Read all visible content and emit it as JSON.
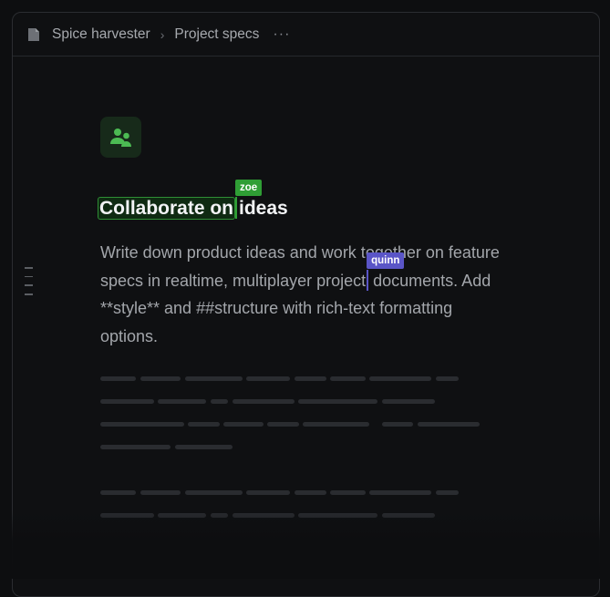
{
  "breadcrumb": {
    "project": "Spice harvester",
    "separator": "›",
    "page": "Project specs",
    "more": "···"
  },
  "icons": {
    "doc": "file-icon",
    "app": "users-icon",
    "more": "more-horizontal-icon",
    "handle": "drag-handle-icon"
  },
  "colors": {
    "zoe": "#2f9e35",
    "quinn": "#5a55c7",
    "app_icon_bg": "#172a1a",
    "app_icon_fg": "#4cbb53"
  },
  "document": {
    "heading_highlighted": "Collaborate on",
    "heading_rest": "ideas",
    "body_part1": "Write down product ideas and work together on feature specs in realtime, multiplayer project",
    "body_part2": " documents. Add **style** and ##structure with rich-text formatting options."
  },
  "collaborators": {
    "zoe": "zoe",
    "quinn": "quinn"
  }
}
